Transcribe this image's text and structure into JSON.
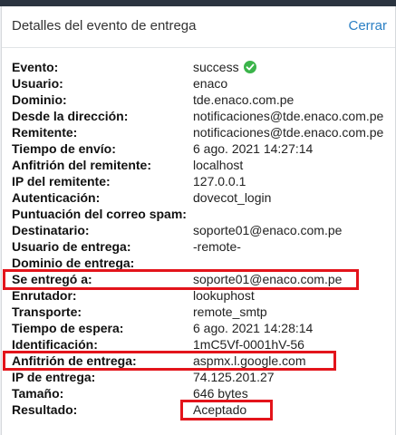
{
  "dialog": {
    "title": "Detalles del evento de entrega",
    "close_label": "Cerrar"
  },
  "details": [
    {
      "label": "Evento:",
      "value": "success",
      "icon": "check-circle-icon"
    },
    {
      "label": "Usuario:",
      "value": "enaco"
    },
    {
      "label": "Dominio:",
      "value": "tde.enaco.com.pe"
    },
    {
      "label": "Desde la dirección:",
      "value": "notificaciones@tde.enaco.com.pe"
    },
    {
      "label": "Remitente:",
      "value": "notificaciones@tde.enaco.com.pe"
    },
    {
      "label": "Tiempo de envío:",
      "value": "6 ago. 2021 14:27:14"
    },
    {
      "label": "Anfitrión del remitente:",
      "value": "localhost"
    },
    {
      "label": "IP del remitente:",
      "value": "127.0.0.1"
    },
    {
      "label": "Autenticación:",
      "value": "dovecot_login"
    },
    {
      "label": "Puntuación del correo spam:",
      "value": ""
    },
    {
      "label": "Destinatario:",
      "value": "soporte01@enaco.com.pe"
    },
    {
      "label": "Usuario de entrega:",
      "value": "-remote-"
    },
    {
      "label": "Dominio de entrega:",
      "value": ""
    },
    {
      "label": "Se entregó a:",
      "value": "soporte01@enaco.com.pe"
    },
    {
      "label": "Enrutador:",
      "value": "lookuphost"
    },
    {
      "label": "Transporte:",
      "value": "remote_smtp"
    },
    {
      "label": "Tiempo de espera:",
      "value": "6 ago. 2021 14:28:14"
    },
    {
      "label": "Identificación:",
      "value": "1mC5Vf-0001hV-56"
    },
    {
      "label": "Anfitrión de entrega:",
      "value": "aspmx.l.google.com"
    },
    {
      "label": "IP de entrega:",
      "value": "74.125.201.27"
    },
    {
      "label": "Tamaño:",
      "value": "646 bytes"
    },
    {
      "label": "Resultado:",
      "value": "Aceptado"
    }
  ],
  "colors": {
    "highlight": "#e3141b",
    "link": "#2a7fc4",
    "success": "#3bb44a"
  }
}
